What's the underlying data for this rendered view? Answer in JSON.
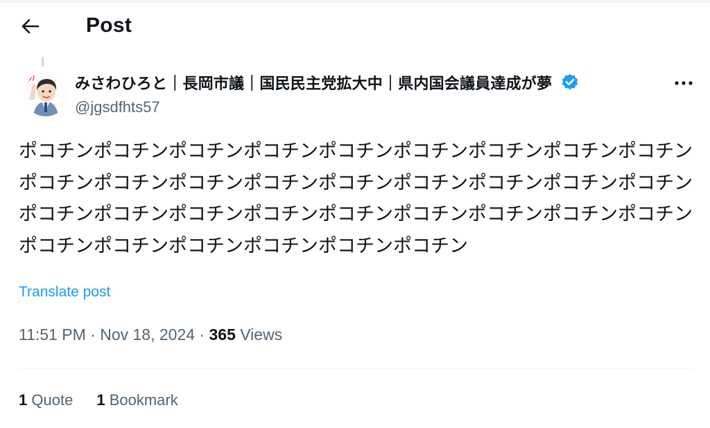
{
  "header": {
    "title": "Post",
    "back_icon": "arrow-left-icon"
  },
  "post": {
    "author": {
      "display_name": "みさわひろと｜長岡市議｜国民民主党拡大中｜県内国会議員達成が夢",
      "handle": "@jgsdfhts57",
      "verified": true,
      "verified_color": "#1d9bf0"
    },
    "text": "ポコチンポコチンポコチンポコチンポコチンポコチンポコチンポコチンポコチンポコチンポコチンポコチンポコチンポコチンポコチンポコチンポコチンポコチンポコチンポコチンポコチンポコチンポコチンポコチンポコチンポコチンポコチンポコチンポコチンポコチンポコチンポコチンポコチン",
    "translate_label": "Translate post",
    "time": "11:51 PM",
    "date": "Nov 18, 2024",
    "separator": "·",
    "views_count": "365",
    "views_label": "Views"
  },
  "stats": {
    "quotes": {
      "count": "1",
      "label": "Quote"
    },
    "bookmarks": {
      "count": "1",
      "label": "Bookmark"
    }
  },
  "colors": {
    "link": "#1d9bf0",
    "secondary_text": "#536471",
    "primary_text": "#0f1419"
  }
}
